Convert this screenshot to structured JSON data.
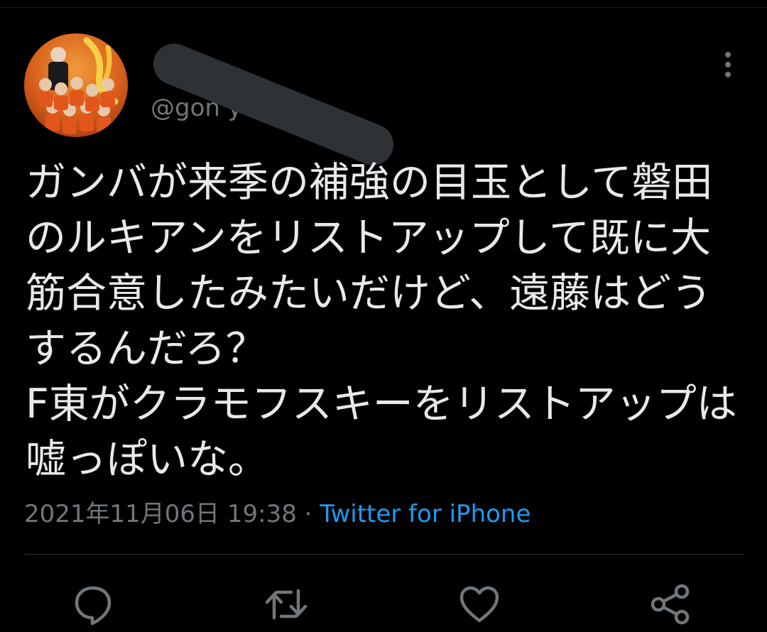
{
  "colors": {
    "background": "#000000",
    "text_primary": "#e7e9ea",
    "text_secondary": "#71767b",
    "link": "#1d9bf0",
    "divider": "#2f3336",
    "redaction": "#2e3135"
  },
  "author": {
    "display_name": "",
    "handle_visible": "@gon                yone"
  },
  "tweet": {
    "text": "ガンバが来季の補強の目玉として磐田のルキアンをリストアップして既に大筋合意したみたいだけど、遠藤はどうするんだろ？\nF東がクラモフスキーをリストアップは嘘っぽいな。",
    "timestamp": "2021年11月06日 19:38",
    "separator": " · ",
    "source": "Twitter for iPhone"
  },
  "icons": {
    "more": "more-vertical-icon",
    "reply": "reply-bubble-icon",
    "retweet": "retweet-icon",
    "like": "heart-icon",
    "share": "share-icon"
  }
}
